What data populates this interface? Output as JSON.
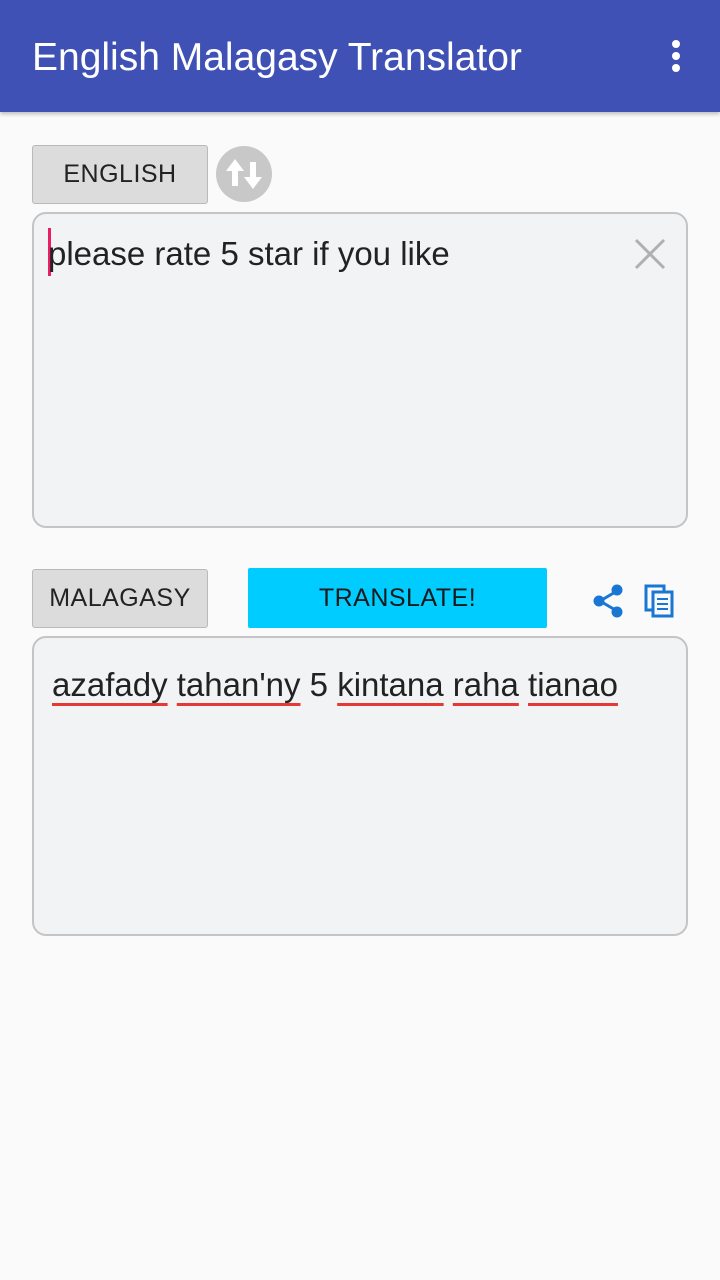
{
  "app": {
    "title": "English Malagasy Translator",
    "overflow_icon": "more-vert-icon"
  },
  "source": {
    "language_label": "ENGLISH",
    "swap_icon": "swap-vertical-icon",
    "input_value": "please rate 5 star if you like",
    "clear_icon": "close-icon"
  },
  "target": {
    "language_label": "MALAGASY",
    "translate_label": "TRANSLATE!",
    "share_icon": "share-icon",
    "copy_icon": "copy-icon",
    "output_words": [
      "azafady",
      "tahan'ny",
      "5",
      "kintana",
      "raha",
      "tianao"
    ]
  },
  "colors": {
    "appbar": "#3f51b5",
    "translate_button": "#00ccff",
    "icon_accent": "#1976d2",
    "caret": "#e91e63",
    "spellcheck_underline": "#e53935"
  }
}
